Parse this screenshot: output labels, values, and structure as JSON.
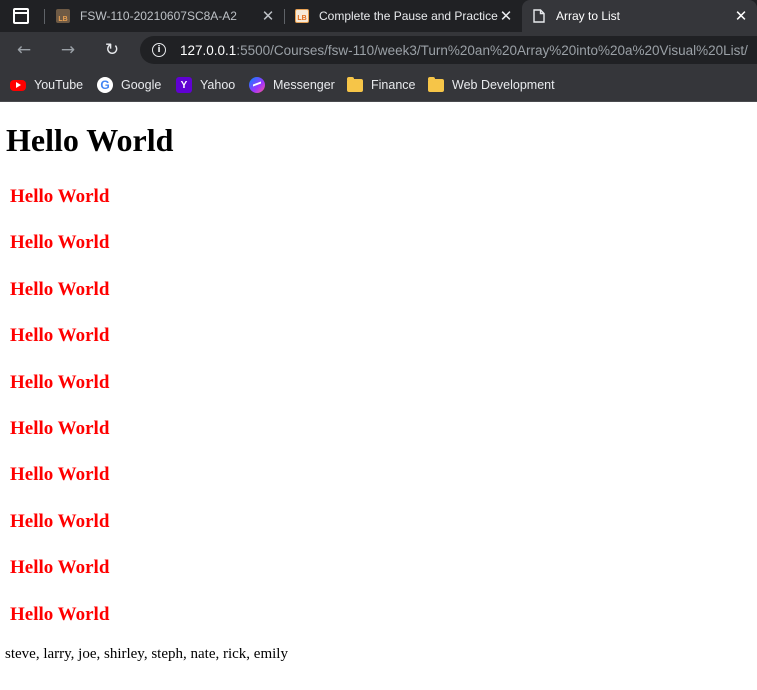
{
  "browser": {
    "tabs": [
      {
        "title": "FSW-110-20210607SC8A-A2",
        "favicon_text": "LB"
      },
      {
        "title": "Complete the Pause and Practice",
        "favicon_text": "LB"
      },
      {
        "title": "Array to List",
        "favicon_text": ""
      }
    ],
    "tab_close_glyph": "✕",
    "url_host": "127.0.0.1",
    "url_rest": ":5500/Courses/fsw-110/week3/Turn%20an%20Array%20into%20a%20Visual%20List/",
    "info_glyph": "i",
    "nav_back_glyph": "←",
    "nav_forward_glyph": "→",
    "nav_reload_glyph": "↻",
    "bookmarks": [
      {
        "label": "YouTube",
        "icon": "youtube-icon"
      },
      {
        "label": "Google",
        "icon": "google-icon",
        "icon_text": "G"
      },
      {
        "label": "Yahoo",
        "icon": "yahoo-icon",
        "icon_text": "Y"
      },
      {
        "label": "Messenger",
        "icon": "messenger-icon"
      },
      {
        "label": "Finance",
        "icon": "folder-icon"
      },
      {
        "label": "Web Development",
        "icon": "folder-icon"
      }
    ]
  },
  "page": {
    "heading": "Hello World",
    "repeated_items": [
      "Hello World",
      "Hello World",
      "Hello World",
      "Hello World",
      "Hello World",
      "Hello World",
      "Hello World",
      "Hello World",
      "Hello World",
      "Hello World"
    ],
    "names_text": "steve, larry, joe, shirley, steph, nate, rick, emily",
    "colors": {
      "repeated_item": "#ff0000",
      "heading": "#000000"
    }
  }
}
